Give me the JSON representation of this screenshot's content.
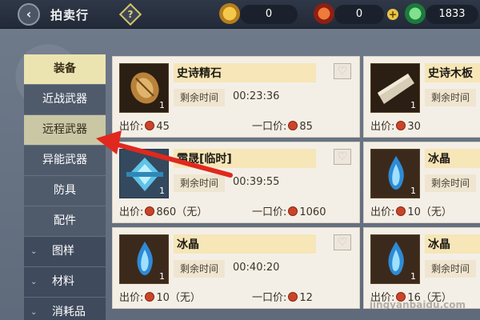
{
  "window": {
    "title": "拍卖行"
  },
  "header": {
    "help_label": "?",
    "currency_1": "0",
    "currency_2": "0",
    "currency_3": "1833",
    "add_label": "+"
  },
  "sidebar": {
    "items": [
      {
        "label": "装备",
        "state": "main-active"
      },
      {
        "label": "近战武器",
        "state": "sub"
      },
      {
        "label": "远程武器",
        "state": "sub-active"
      },
      {
        "label": "异能武器",
        "state": "sub"
      },
      {
        "label": "防具",
        "state": "sub"
      },
      {
        "label": "配件",
        "state": "sub"
      },
      {
        "label": "图样",
        "state": "cat"
      },
      {
        "label": "材料",
        "state": "cat"
      },
      {
        "label": "消耗品",
        "state": "cat"
      }
    ]
  },
  "labels": {
    "remaining_time": "剩余时间",
    "bid_price": "出价:",
    "buyout_price": "一口价:"
  },
  "listings": [
    {
      "name": "史诗精石",
      "time": "00:23:36",
      "qty": "1",
      "bid": "45",
      "buyout": "85"
    },
    {
      "name": "霜晟[临时]",
      "time": "00:39:55",
      "qty": "1",
      "bid": "860（无）",
      "buyout": "1060"
    },
    {
      "name": "冰晶",
      "time": "00:40:20",
      "qty": "1",
      "bid": "10（无）",
      "buyout": "12"
    },
    {
      "name": "史诗木板",
      "time": "",
      "qty": "1",
      "bid": "30",
      "buyout": ""
    },
    {
      "name": "冰晶",
      "time": "",
      "qty": "1",
      "bid": "10（无）",
      "buyout": ""
    },
    {
      "name": "冰晶",
      "time": "",
      "qty": "1",
      "bid": "16（无）",
      "buyout": ""
    }
  ],
  "watermark": "jingyanbaidu.com",
  "colors": {
    "accent": "#ece4b0",
    "coin": "#c9452a",
    "arrow": "#e0281e"
  }
}
